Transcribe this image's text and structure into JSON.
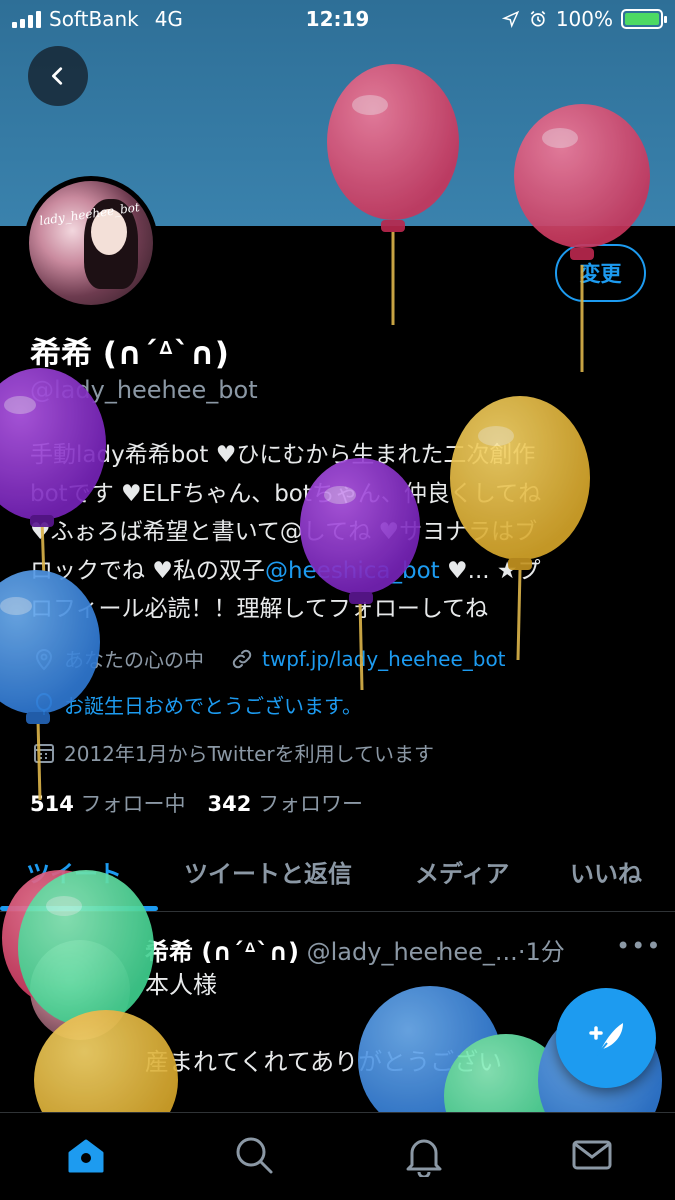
{
  "status_bar": {
    "carrier": "SoftBank",
    "network": "4G",
    "time": "12:19",
    "battery": "100%"
  },
  "profile": {
    "change_label": "変更",
    "name": "希希 (∩´ᐞ`∩)",
    "handle": "@lady_heehee_bot",
    "bio_parts": {
      "line1": "手動lady希希bot ♥ひにむから生まれた二次創作",
      "line2": "botです ♥ELFちゃん、botちゃん、仲良くしてね",
      "line3": "♥ふぉろば希望と書いて@してね ♥サヨナラはブ",
      "line4_pre": "ロックでね ♥私の双子",
      "mention": "@heeshica_bot",
      "line4_post": " ♥... ★プ",
      "line5": "ロフィール必読！！理解してフォローしてね"
    },
    "location": "あなたの心の中",
    "link": "twpf.jp/lady_heehee_bot",
    "birthday": "お誕生日おめでとうございます。",
    "joined": "2012年1月からTwitterを利用しています",
    "following_count": "514",
    "following_label": "フォロー中",
    "followers_count": "342",
    "followers_label": "フォロワー"
  },
  "tabs": [
    {
      "label": "ツイート"
    },
    {
      "label": "ツイートと返信"
    },
    {
      "label": "メディア"
    },
    {
      "label": "いいね"
    }
  ],
  "tweet": {
    "name": "希希 (∩´ᐞ`∩)",
    "handle": "@lady_heehee_...",
    "time": "·1分",
    "more": "•••",
    "text1": "本人様",
    "text2": "産まれてくれてありがとうござい"
  },
  "colors": {
    "accent": "#1d9bf0",
    "banner": "#3a82ad",
    "background": "#000000"
  },
  "icons": {
    "back": "chevron-left-icon",
    "location": "map-pin-icon",
    "link": "link-icon",
    "birthday": "balloon-icon",
    "joined": "calendar-icon",
    "compose": "feather-plus-icon",
    "nav": [
      "home-icon",
      "search-icon",
      "bell-icon",
      "mail-icon"
    ]
  }
}
